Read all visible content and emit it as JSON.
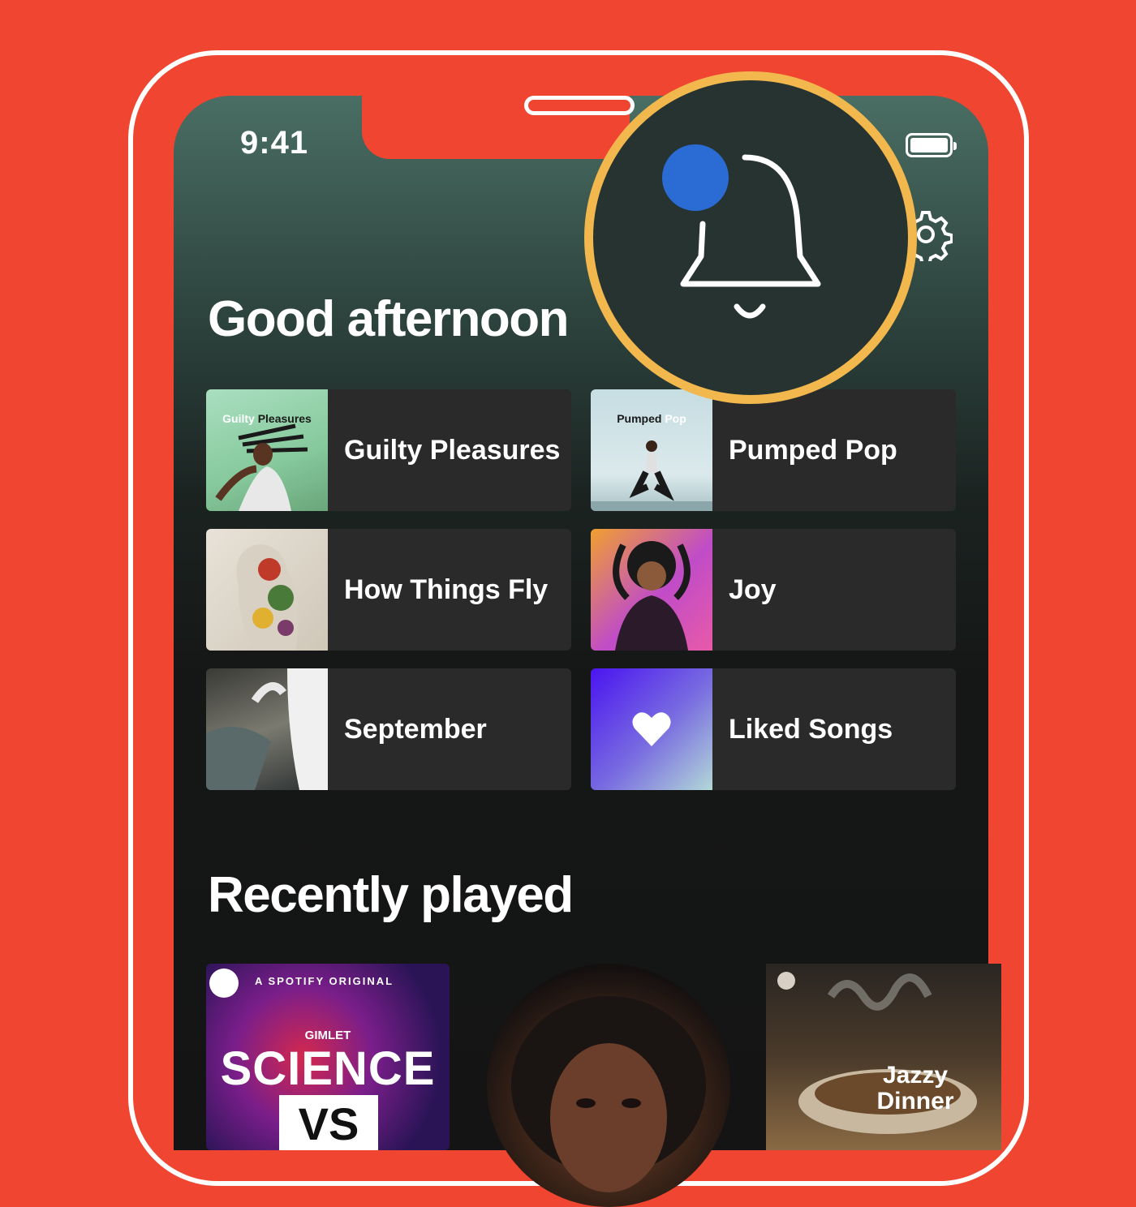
{
  "status_bar": {
    "time": "9:41"
  },
  "home": {
    "greeting": "Good afternoon",
    "shortcuts": [
      {
        "name": "Guilty Pleasures",
        "art_text_1": "Guilty",
        "art_text_2": "Pleasures"
      },
      {
        "name": "Pumped Pop",
        "art_text_1": "Pumped",
        "art_text_2": "Pop"
      },
      {
        "name": "How Things Fly"
      },
      {
        "name": "Joy"
      },
      {
        "name": "September"
      },
      {
        "name": "Liked Songs"
      }
    ],
    "recently_played_title": "Recently played",
    "recently_played": [
      {
        "kicker": "A SPOTIFY ORIGINAL",
        "publisher": "GIMLET",
        "title_line1": "SCIENCE",
        "title_line2": "VS"
      },
      {
        "type": "artist"
      },
      {
        "title": "Jazzy Dinner"
      }
    ]
  },
  "icons": {
    "notifications": "bell-icon",
    "settings": "gear-icon",
    "liked": "heart-icon",
    "unread_indicator": "blue-dot"
  },
  "colors": {
    "background": "#f04530",
    "highlight_ring": "#f2b84e",
    "notification_dot": "#2a6bd4",
    "tile": "#2a2a2a"
  }
}
